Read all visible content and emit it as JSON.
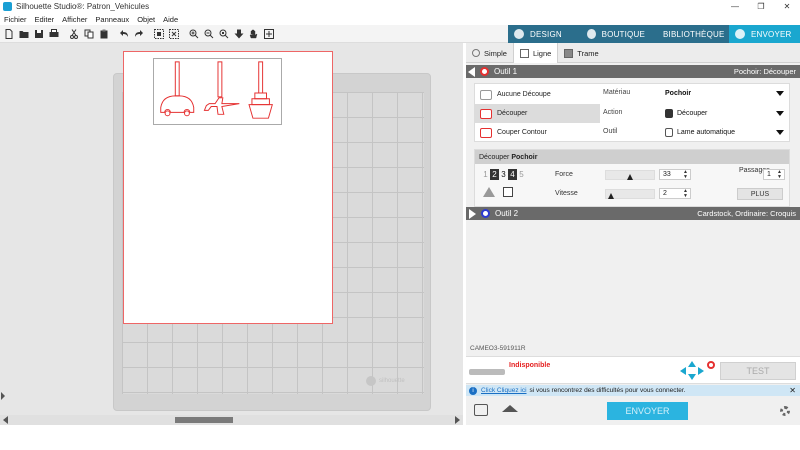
{
  "window": {
    "title": "Silhouette Studio®: Patron_Vehicules",
    "controls": [
      "—",
      "❐",
      "✕"
    ]
  },
  "menu": [
    "Fichier",
    "Editer",
    "Afficher",
    "Panneaux",
    "Objet",
    "Aide"
  ],
  "toolbar": {
    "icons": [
      "new-icon",
      "open-icon",
      "save-icon",
      "print-icon",
      "cut-icon",
      "copy-icon",
      "paste-icon",
      "undo-icon",
      "redo-icon",
      "group-icon",
      "ungroup-icon",
      "zoom-in-icon",
      "zoom-out-icon",
      "zoom-area-icon",
      "move-down-icon",
      "pan-hand-icon",
      "fit-page-icon"
    ]
  },
  "nav_tabs": [
    {
      "label": "DESIGN",
      "icon": "design-icon"
    },
    {
      "label": "BOUTIQUE",
      "icon": "store-icon"
    },
    {
      "label": "BIBLIOTHÈQUE",
      "icon": "library-icon"
    },
    {
      "label": "ENVOYER",
      "icon": "send-icon",
      "active": true
    }
  ],
  "canvas": {
    "shapes": [
      "car",
      "plane",
      "boat"
    ],
    "mat_logo": "silhouette"
  },
  "panel": {
    "mode_tabs": [
      {
        "label": "Simple",
        "active": false
      },
      {
        "label": "Ligne",
        "active": true
      },
      {
        "label": "Trame",
        "active": false
      }
    ],
    "tool1": {
      "label": "Outil 1",
      "summary": "Pochoir: Découper",
      "cut_options": [
        {
          "label": "Aucune Découpe",
          "selected": false
        },
        {
          "label": "Découper",
          "selected": true
        },
        {
          "label": "Couper Contour",
          "selected": false
        }
      ],
      "material_label": "Matériau",
      "material_value": "Pochoir",
      "action_label": "Action",
      "action_value": "Découper",
      "tool_label": "Outil",
      "tool_value": "Lame automatique"
    },
    "settings": {
      "header_prefix": "Découper",
      "header_material": "Pochoir",
      "pass_digits": [
        "1",
        "2",
        "3",
        "4",
        "5"
      ],
      "force_label": "Force",
      "force_value": "33",
      "force_level": 0.33,
      "passes_label": "Passages",
      "passes_value": "1",
      "speed_label": "Vitesse",
      "speed_value": "2",
      "speed_level": 0.1,
      "plus_label": "PLUS"
    },
    "tool2": {
      "label": "Outil 2",
      "summary": "Cardstock, Ordinaire: Croquis"
    },
    "device": {
      "name": "CAMEO3-591911R",
      "status": "Indisponible",
      "test_label": "TEST"
    },
    "info": {
      "link": "Click Cliquez ici",
      "text": "si vous rencontrez des difficultés pour vous connecter."
    },
    "send_label": "ENVOYER"
  },
  "colors": {
    "accent": "#1aa7cf",
    "nav_bg": "#2b6e8c",
    "cut_line": "#e53030",
    "tool2_ring": "#2c3ad0",
    "status_red": "#e52020"
  }
}
